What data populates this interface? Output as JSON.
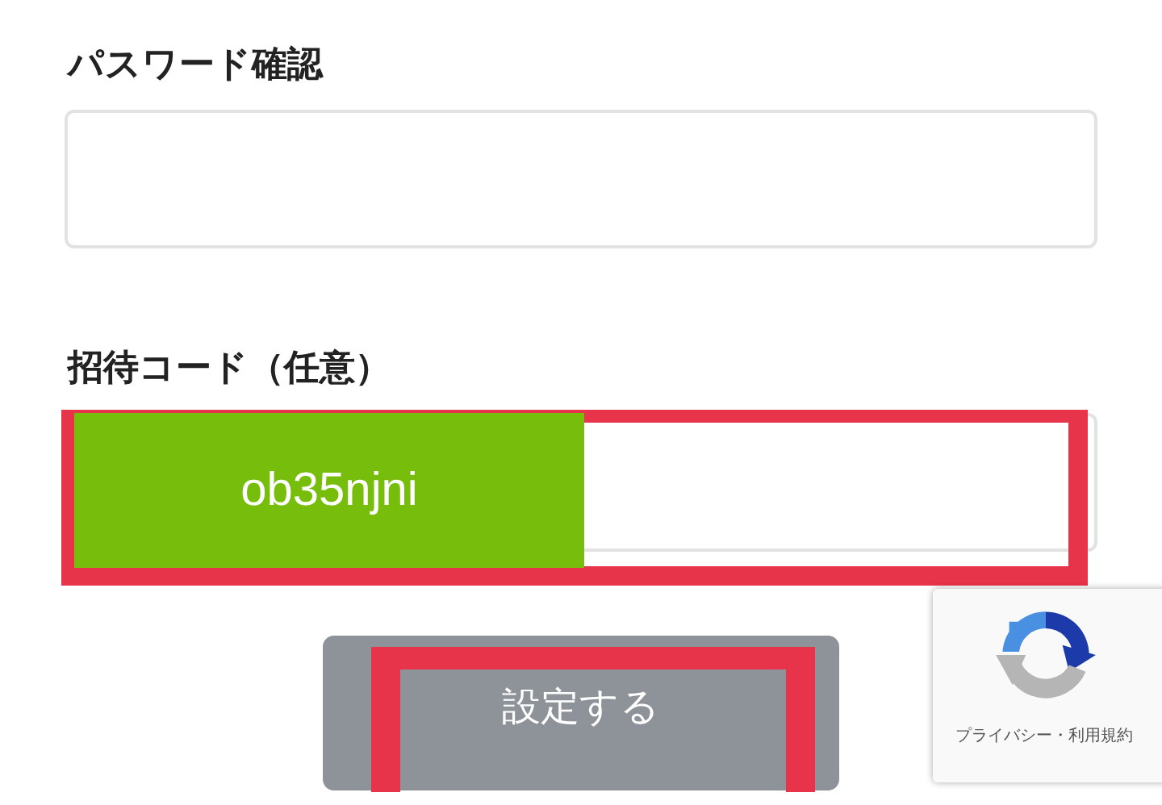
{
  "fields": [
    {
      "label": "パスワード確認",
      "kind": "password",
      "highlighted": false
    },
    {
      "label": "招待コード（任意）",
      "kind": "code",
      "value": "ob35njni",
      "highlighted": true
    }
  ],
  "submit": {
    "label": "設定する",
    "highlighted": true
  },
  "recaptcha": {
    "links": "プライバシー・利用規約"
  }
}
